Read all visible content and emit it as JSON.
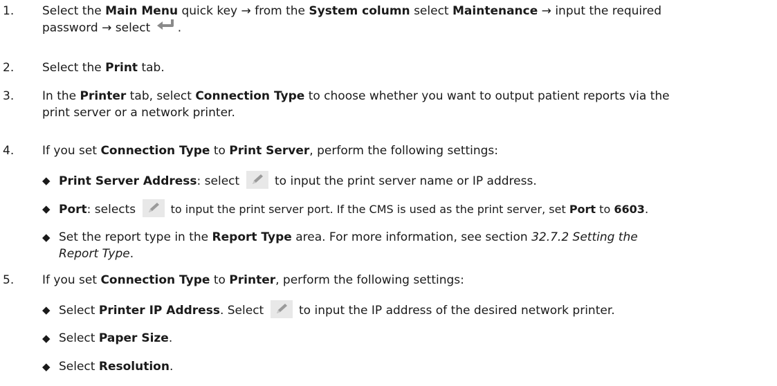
{
  "steps": {
    "s1": {
      "num": "1.",
      "a": "Select the ",
      "b1": "Main Menu",
      "c": " quick key → from the ",
      "b2": "System column",
      "d": " select ",
      "b3": "Maintenance",
      "e": " → input the required",
      "f": "password → select ",
      "g": "."
    },
    "s2": {
      "num": "2.",
      "a": "Select the ",
      "b1": "Print",
      "c": " tab."
    },
    "s3": {
      "num": "3.",
      "a": "In the ",
      "b1": "Printer",
      "c": " tab, select ",
      "b2": "Connection Type",
      "d": " to choose whether you want to output patient reports via the",
      "e": "print server or a network printer."
    },
    "s4": {
      "num": "4.",
      "a": "If you set ",
      "b1": "Connection Type",
      "c": " to ",
      "b2": "Print Server",
      "d": ", perform the following settings:",
      "bullet1": {
        "b1": "Print Server Address",
        "a": ": select ",
        "c": " to input the print server name or IP address."
      },
      "bullet2": {
        "b1": "Port",
        "a": ": selects ",
        "c": " to input the print server port. If the CMS is used as the print server, set ",
        "b2": "Port",
        "d": " to ",
        "b3": "6603",
        "e": "."
      },
      "bullet3": {
        "a": "Set the report type in the ",
        "b1": "Report Type",
        "c": " area. For more information, see section ",
        "i1": "32.7.2 Setting the",
        "i2": "Report Type",
        "d": "."
      }
    },
    "s5": {
      "num": "5.",
      "a": "If you set ",
      "b1": "Connection Type",
      "c": " to ",
      "b2": "Printer",
      "d": ", perform the following settings:",
      "bullet1": {
        "a": "Select ",
        "b1": "Printer IP Address",
        "c": ". Select ",
        "d": " to input the IP address of the desired network printer."
      },
      "bullet2": {
        "a": "Select ",
        "b1": "Paper Size",
        "c": "."
      },
      "bullet3": {
        "a": "Select ",
        "b1": "Resolution",
        "c": "."
      }
    }
  },
  "bullet_glyph": "◆",
  "icons": {
    "enter": "enter-arrow-icon",
    "edit": "pencil-icon"
  },
  "colors": {
    "text": "#1a1a1a",
    "icon_bg": "#e8e8e8",
    "icon_fg": "#8a8a8a"
  }
}
